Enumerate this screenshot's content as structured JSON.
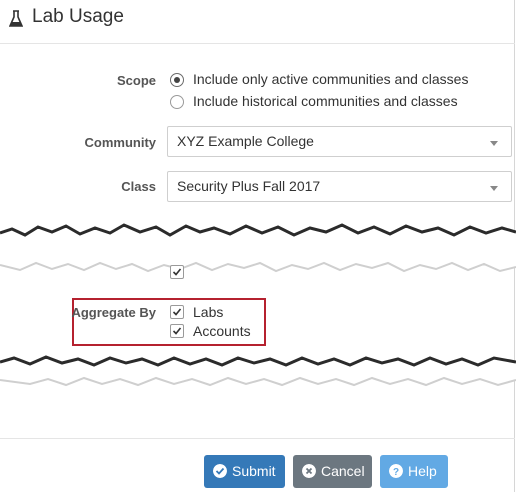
{
  "header": {
    "title": "Lab Usage",
    "icon": "flask-icon"
  },
  "scope": {
    "label": "Scope",
    "options": [
      {
        "label": "Include only active communities and classes",
        "checked": true
      },
      {
        "label": "Include historical communities and classes",
        "checked": false
      }
    ]
  },
  "community": {
    "label": "Community",
    "value": "XYZ Example College"
  },
  "class": {
    "label": "Class",
    "value": "Security Plus Fall 2017"
  },
  "aggregate": {
    "label": "Aggregate By",
    "options": [
      {
        "label": "Labs",
        "checked": true
      },
      {
        "label": "Accounts",
        "checked": true
      }
    ]
  },
  "buttons": {
    "submit": "Submit",
    "cancel": "Cancel",
    "help": "Help"
  },
  "colors": {
    "submit": "#3579b8",
    "cancel": "#6c7780",
    "help": "#62a9e4",
    "highlight": "#b5212f"
  }
}
